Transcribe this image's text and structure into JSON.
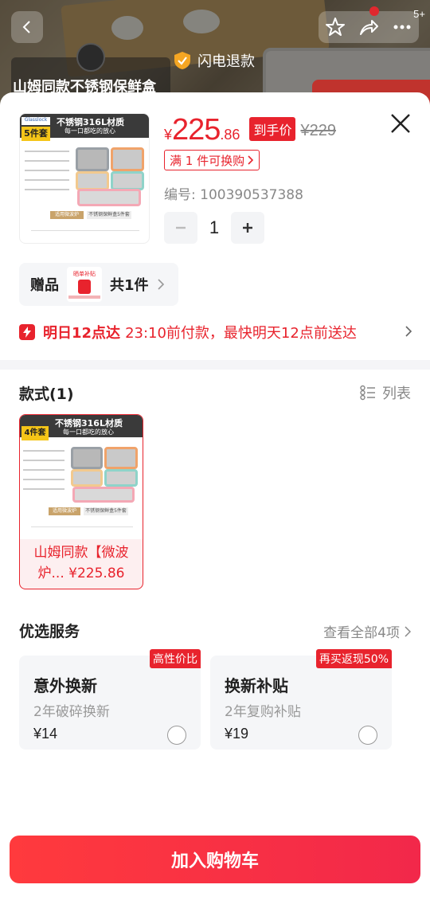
{
  "background": {
    "title": "山姆同款不锈钢保鲜盒",
    "flash_refund": "闪电退款",
    "cart_count": "5+"
  },
  "product": {
    "image_headline": "不锈钢316L材质",
    "image_subline": "每一口都吃的放心",
    "image_set_badge": "5件套",
    "image_brand": "Glasslock",
    "image_tag_left": "适用微波炉",
    "image_tag_right": "不锈钢保鲜盒5件套",
    "price_symbol": "¥",
    "price_int": "225",
    "price_dec": ".86",
    "deal_label": "到手价",
    "original_price": "¥229",
    "promo": "满 1 件可换购",
    "sku_code": "编号: 100390537388",
    "quantity": "1"
  },
  "gift": {
    "label": "赠品",
    "count": "共1件",
    "img_text": "晒单补贴"
  },
  "delivery": {
    "strong": "明日12点达",
    "text": "23:10前付款，最快明天12点前送达"
  },
  "style_section": {
    "title": "款式(1)",
    "view_toggle": "列表",
    "items": [
      {
        "name": "山姆同款【微波炉... ¥225.86",
        "badge": "4件套"
      }
    ]
  },
  "services": {
    "title": "优选服务",
    "more": "查看全部4项",
    "items": [
      {
        "tag": "高性价比",
        "title": "意外换新",
        "sub": "2年破碎换新",
        "price": "¥14"
      },
      {
        "tag": "再买返现50%",
        "title": "换新补贴",
        "sub": "2年复购补贴",
        "price": "¥19"
      }
    ]
  },
  "cta": {
    "add_to_cart": "加入购物车"
  },
  "colors": {
    "accent": "#e8232d",
    "muted": "#888888"
  }
}
